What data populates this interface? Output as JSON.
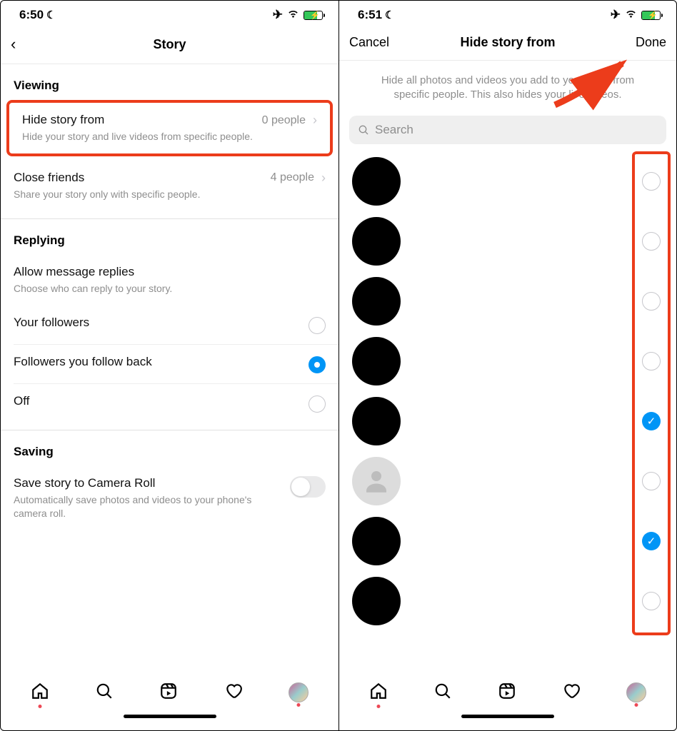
{
  "left": {
    "status": {
      "time": "6:50"
    },
    "header": {
      "title": "Story"
    },
    "sections": {
      "viewing": {
        "label": "Viewing",
        "hide_story": {
          "title": "Hide story from",
          "sub": "Hide your story and live videos from specific people.",
          "value": "0 people"
        },
        "close_friends": {
          "title": "Close friends",
          "sub": "Share your story only with specific people.",
          "value": "4 people"
        }
      },
      "replying": {
        "label": "Replying",
        "allow": {
          "title": "Allow message replies",
          "sub": "Choose who can reply to your story."
        },
        "options": {
          "followers": {
            "label": "Your followers",
            "selected": false
          },
          "followback": {
            "label": "Followers you follow back",
            "selected": true
          },
          "off": {
            "label": "Off",
            "selected": false
          }
        }
      },
      "saving": {
        "label": "Saving",
        "save_roll": {
          "title": "Save story to Camera Roll",
          "sub": "Automatically save photos and videos to your phone's camera roll."
        }
      }
    }
  },
  "right": {
    "status": {
      "time": "6:51"
    },
    "header": {
      "cancel": "Cancel",
      "title": "Hide story from",
      "done": "Done"
    },
    "info": "Hide all photos and videos you add to your story from specific people. This also hides your live videos.",
    "search_placeholder": "Search",
    "users": [
      {
        "checked": false,
        "placeholder": false
      },
      {
        "checked": false,
        "placeholder": false
      },
      {
        "checked": false,
        "placeholder": false
      },
      {
        "checked": false,
        "placeholder": false
      },
      {
        "checked": true,
        "placeholder": false
      },
      {
        "checked": false,
        "placeholder": true
      },
      {
        "checked": true,
        "placeholder": false
      },
      {
        "checked": false,
        "placeholder": false
      }
    ]
  }
}
